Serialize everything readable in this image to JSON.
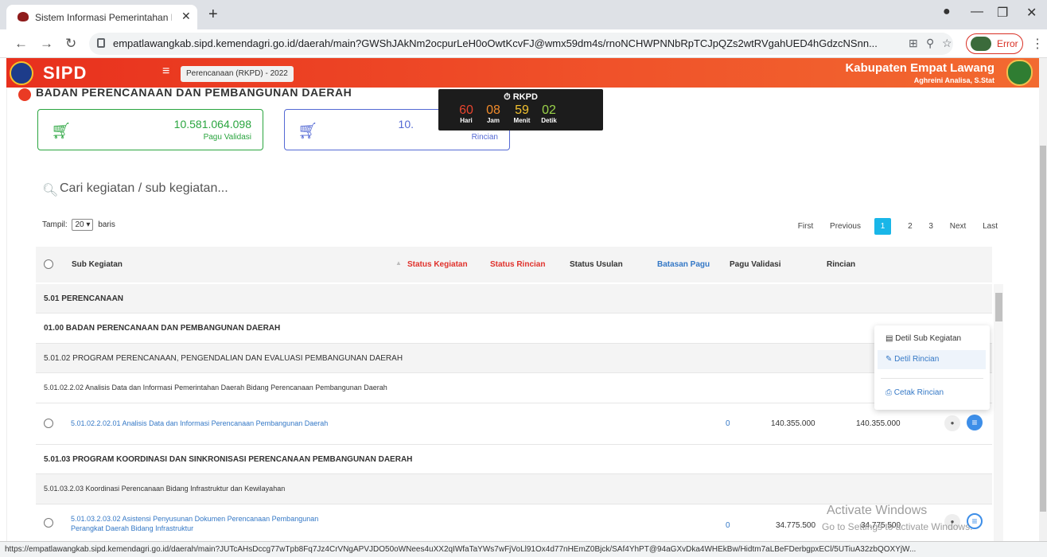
{
  "browser": {
    "tab_title": "Sistem Informasi Pemerintahan D",
    "url": "empatlawangkab.sipd.kemendagri.go.id/daerah/main?GWShJAkNm2ocpurLeH0oOwtKcvFJ@wmx59dm4s/rnoNCHWPNNbRpTCJpQZs2wtRVgahUED4hGdzcNSnn...",
    "error_label": "Error",
    "status_url": "https://empatlawangkab.sipd.kemendagri.go.id/daerah/main?JUTcAHsDccg77wTpb8Fq7Jz4CrVNgAPVJDO50oWNees4uXX2qIWfaTaYWs7wFjVoLl91Ox4d77nHEmZ0Bjck/SAf4YhPT@94aGXvDka4WHEkBw/Hidtm7aLBeFDerbgpxECl/5UTiuA32zbQOXYjW..."
  },
  "header": {
    "logo": "SIPD",
    "module": "Perencanaan (RKPD) - 2022",
    "region": "Kabupaten Empat Lawang",
    "user": "Aghreini Analisa, S.Stat"
  },
  "section_title": "BADAN PERENCANAAN DAN PEMBANGUNAN DAERAH",
  "cards": [
    {
      "value": "10.581.064.098",
      "label": "Pagu Validasi"
    },
    {
      "value": "10.",
      "label": "Rincian"
    }
  ],
  "timer": {
    "title": "RKPD",
    "units": [
      {
        "value": "60",
        "label": "Hari",
        "color": "#e8442e"
      },
      {
        "value": "08",
        "label": "Jam",
        "color": "#f08a2a"
      },
      {
        "value": "59",
        "label": "Menit",
        "color": "#f2c230"
      },
      {
        "value": "02",
        "label": "Detik",
        "color": "#9bd34a"
      }
    ]
  },
  "search": {
    "placeholder": "Cari kegiatan / sub kegiatan..."
  },
  "length": {
    "prefix": "Tampil:",
    "value": "20",
    "suffix": "baris"
  },
  "pager": {
    "first": "First",
    "previous": "Previous",
    "pages": [
      "1",
      "2",
      "3"
    ],
    "current": "1",
    "next": "Next",
    "last": "Last"
  },
  "table": {
    "columns": {
      "sub_kegiatan": "Sub Kegiatan",
      "status_kegiatan": "Status Kegiatan",
      "status_rincian": "Status Rincian",
      "status_usulan": "Status Usulan",
      "batasan_pagu": "Batasan Pagu",
      "pagu_validasi": "Pagu Validasi",
      "rincian": "Rincian"
    },
    "rows": [
      {
        "text": "5.01 PERENCANAAN"
      },
      {
        "text": "01.00 BADAN PERENCANAAN DAN PEMBANGUNAN DAERAH"
      },
      {
        "text": "5.01.02 PROGRAM PERENCANAAN, PENGENDALIAN DAN EVALUASI PEMBANGUNAN DAERAH"
      },
      {
        "text": "5.01.02.2.02 Analisis Data dan Informasi Pemerintahan Daerah Bidang Perencanaan Pembangunan Daerah"
      },
      {
        "text": "5.01.02.2.02.01 Analisis Data dan Informasi Perencanaan Pembangunan Daerah",
        "batasan": "0",
        "pagu": "140.355.000",
        "rincian": "140.355.000"
      },
      {
        "text": "5.01.03 PROGRAM KOORDINASI DAN SINKRONISASI PERENCANAAN PEMBANGUNAN DAERAH"
      },
      {
        "text": "5.01.03.2.03 Koordinasi Perencanaan Bidang Infrastruktur dan Kewilayahan"
      },
      {
        "text": "5.01.03.2.03.02 Asistensi Penyusunan Dokumen Perencanaan Pembangunan",
        "text2": "Perangkat Daerah Bidang Infrastruktur",
        "batasan": "0",
        "pagu": "34.775.500",
        "rincian": "34.775.500"
      }
    ]
  },
  "context_menu": [
    "Detil Sub Kegiatan",
    "Detil Rincian",
    "Cetak Rincian"
  ],
  "watermark": {
    "line1": "Activate Windows",
    "line2": "Go to Settings to activate Windows."
  }
}
